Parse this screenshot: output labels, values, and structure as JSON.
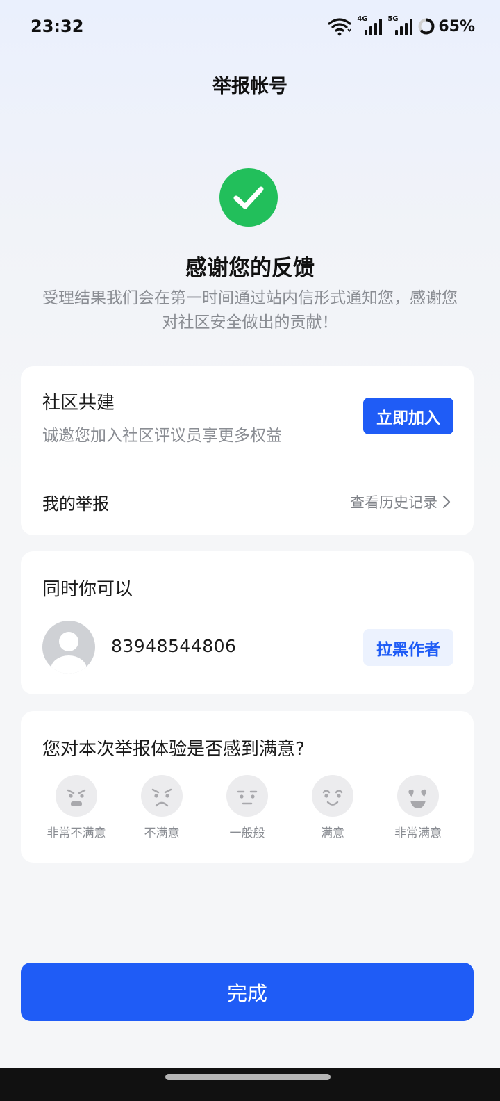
{
  "status_bar": {
    "time": "23:32",
    "network_4g": "4G",
    "network_5g": "5G",
    "battery": "65%",
    "battery_level": 0.65,
    "icons": [
      "wifi-icon",
      "signal-4g-icon",
      "signal-5g-icon",
      "battery-icon"
    ]
  },
  "nav": {
    "title": "举报帐号"
  },
  "result": {
    "icon": "check-icon",
    "title": "感谢您的反馈",
    "subtitle": "受理结果我们会在第一时间通过站内信形式通知您，感谢您对社区安全做出的贡献！"
  },
  "community": {
    "title": "社区共建",
    "subtitle": "诚邀您加入社区评议员享更多权益",
    "join_label": "立即加入",
    "my_report_label": "我的举报",
    "history_label": "查看历史记录",
    "history_icon": "chevron-right-icon"
  },
  "also": {
    "title": "同时你可以",
    "author_id": "83948544806",
    "block_label": "拉黑作者",
    "avatar_icon": "default-avatar-icon"
  },
  "rating": {
    "question": "您对本次举报体验是否感到满意?",
    "options": [
      {
        "label": "非常不满意",
        "icon": "very-dissatisfied-face-icon"
      },
      {
        "label": "不满意",
        "icon": "dissatisfied-face-icon"
      },
      {
        "label": "一般般",
        "icon": "neutral-face-icon"
      },
      {
        "label": "满意",
        "icon": "satisfied-face-icon"
      },
      {
        "label": "非常满意",
        "icon": "very-satisfied-face-icon"
      }
    ]
  },
  "footer": {
    "done_label": "完成"
  },
  "colors": {
    "accent": "#1f5cf6",
    "success": "#22bf5b",
    "muted_text": "#8a8d93",
    "light_accent_bg": "#ecf2fe"
  }
}
